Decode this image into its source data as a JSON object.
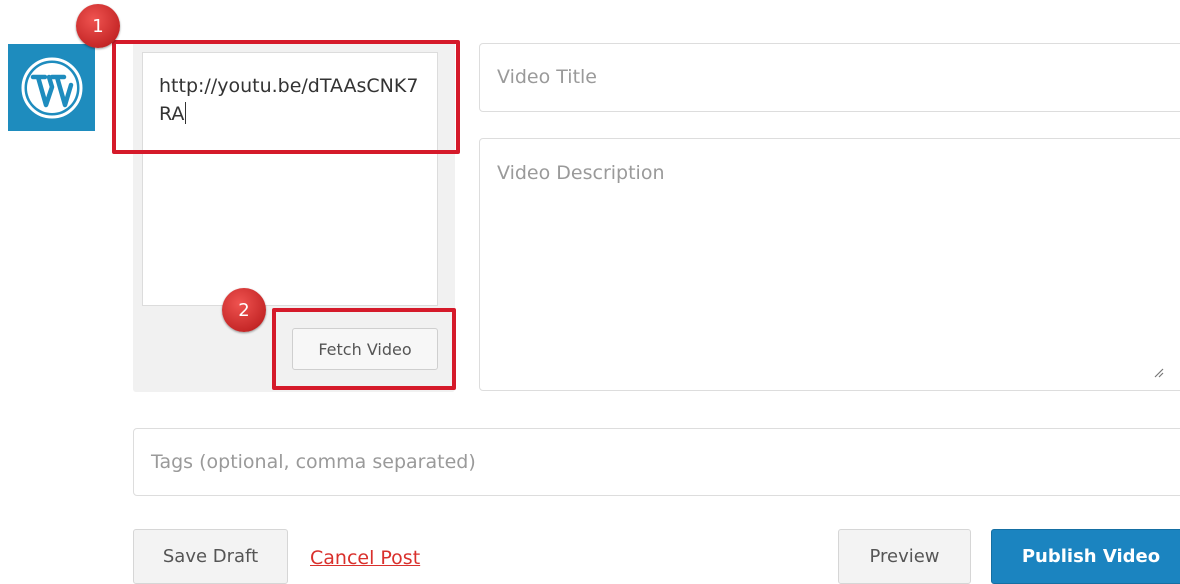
{
  "header": {
    "cut_text": ""
  },
  "composer": {
    "url_value": "http://youtu.be/dTAAsCNK7RA",
    "fetch_label": "Fetch Video",
    "title_placeholder": "Video Title",
    "description_placeholder": "Video Description",
    "tags_placeholder": "Tags (optional, comma separated)"
  },
  "actions": {
    "save_label": "Save Draft",
    "cancel_label": "Cancel Post",
    "preview_label": "Preview",
    "publish_label": "Publish Video"
  },
  "annotations": {
    "step1": "1",
    "step2": "2"
  },
  "colors": {
    "wp_blue": "#1e8cbe",
    "publish_blue": "#1b84c0",
    "annotation_red": "#d51a2a",
    "cancel_red": "#d9302c"
  },
  "icons": [
    "wordpress-logo-icon",
    "resize-grip-icon"
  ]
}
